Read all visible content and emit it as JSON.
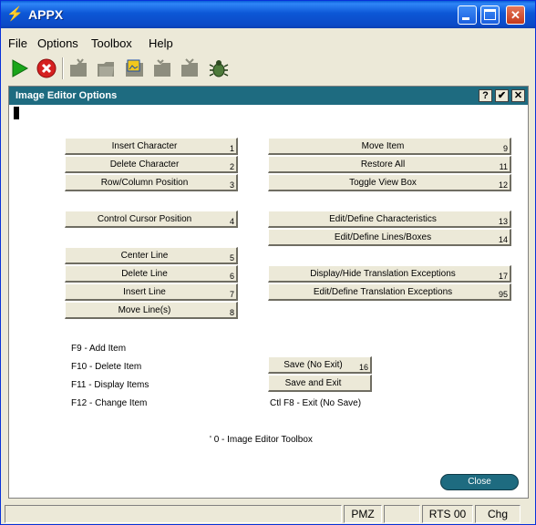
{
  "window": {
    "title": "APPX"
  },
  "menu": [
    "File",
    "Options",
    "Toolbox",
    "Help"
  ],
  "toolbar": {
    "icons": [
      "play-icon",
      "stop-icon",
      "folder-icon",
      "folder-icon",
      "image-folder-icon",
      "folder-icon",
      "folder-icon",
      "bug-icon"
    ],
    "colors": {
      "play": "#1aa51a",
      "stop": "#d52020",
      "folder": "#8d8d7e",
      "highlight": "#f2c81c"
    }
  },
  "dialog": {
    "title": "Image Editor Options",
    "help_btn": "?",
    "ok_btn": "✔",
    "close_btn": "✕",
    "left_buttons": [
      {
        "label": "Insert Character",
        "num": "1"
      },
      {
        "label": "Delete Character",
        "num": "2"
      },
      {
        "label": "Row/Column Position",
        "num": "3"
      },
      {
        "label": "Control Cursor Position",
        "num": "4"
      },
      {
        "label": "Center Line",
        "num": "5"
      },
      {
        "label": "Delete Line",
        "num": "6"
      },
      {
        "label": "Insert Line",
        "num": "7"
      },
      {
        "label": "Move Line(s)",
        "num": "8"
      }
    ],
    "right_buttons": [
      {
        "label": "Move Item",
        "num": "9"
      },
      {
        "label": "Restore All",
        "num": "11"
      },
      {
        "label": "Toggle View Box",
        "num": "12"
      },
      {
        "label": "Edit/Define Characteristics",
        "num": "13"
      },
      {
        "label": "Edit/Define Lines/Boxes",
        "num": "14"
      },
      {
        "label": "Display/Hide Translation Exceptions",
        "num": "17"
      },
      {
        "label": "Edit/Define Translation Exceptions",
        "num": "95"
      }
    ],
    "fkeys": [
      "F9 - Add Item",
      "F10 - Delete Item",
      "F11 - Display Items",
      "F12 - Change Item"
    ],
    "save_buttons": [
      {
        "label": "Save (No Exit)",
        "num": "16"
      },
      {
        "label": "Save and Exit",
        "num": ""
      }
    ],
    "ctl_f8": "Ctl F8 - Exit (No Save)",
    "toolbox_hint": "' 0 - Image Editor Toolbox",
    "close_label": "Close"
  },
  "status": [
    "PMZ",
    "RTS 00",
    "Chg"
  ]
}
